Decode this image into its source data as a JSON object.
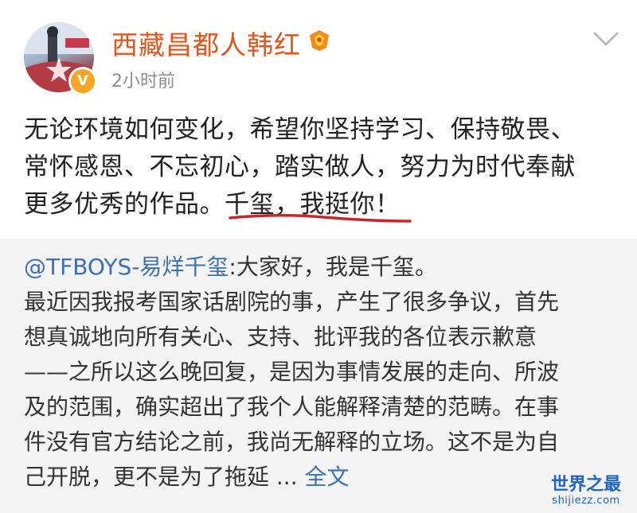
{
  "post": {
    "username": "西藏昌都人韩红",
    "time": "2小时前",
    "verified_mark": "V",
    "text_lines": [
      "无论环境如何变化，希望你坚持学习、保持敬畏、",
      "常怀感恩、不忘初心，踏实做人，努力为时代奉献",
      "更多优秀的作品。千玺，我挺你！"
    ]
  },
  "repost": {
    "mention": "@TFBOYS-易烊千玺",
    "first_line_rest": ":大家好，我是千玺。",
    "lines": [
      "最近因我报考国家话剧院的事，产生了很多争议，首先",
      "想真诚地向所有关心、支持、批评我的各位表示歉意",
      "——之所以这么晚回复，是因为事情发展的走向、所波",
      "及的范围，确实超出了我个人能解释清楚的范畴。在事",
      "件没有官方结论之前，我尚无解释的立场。这不是为自"
    ],
    "last_line": "己开脱，更不是为了拖延 ... ",
    "full_text_link": "全文"
  },
  "watermark": {
    "title": "世界之最",
    "url": "shijiezz.com"
  },
  "colors": {
    "username": "#e5541b",
    "link": "#3b6fb6",
    "underline": "#c8242e",
    "repost_bg": "#f4f4f4",
    "verified_badge": "#f6a623"
  },
  "icons": {
    "avatar": "avatar-image",
    "level_badge": "fan-level-badge-icon",
    "dropdown": "chevron-down-icon",
    "verified": "verified-v-icon"
  }
}
